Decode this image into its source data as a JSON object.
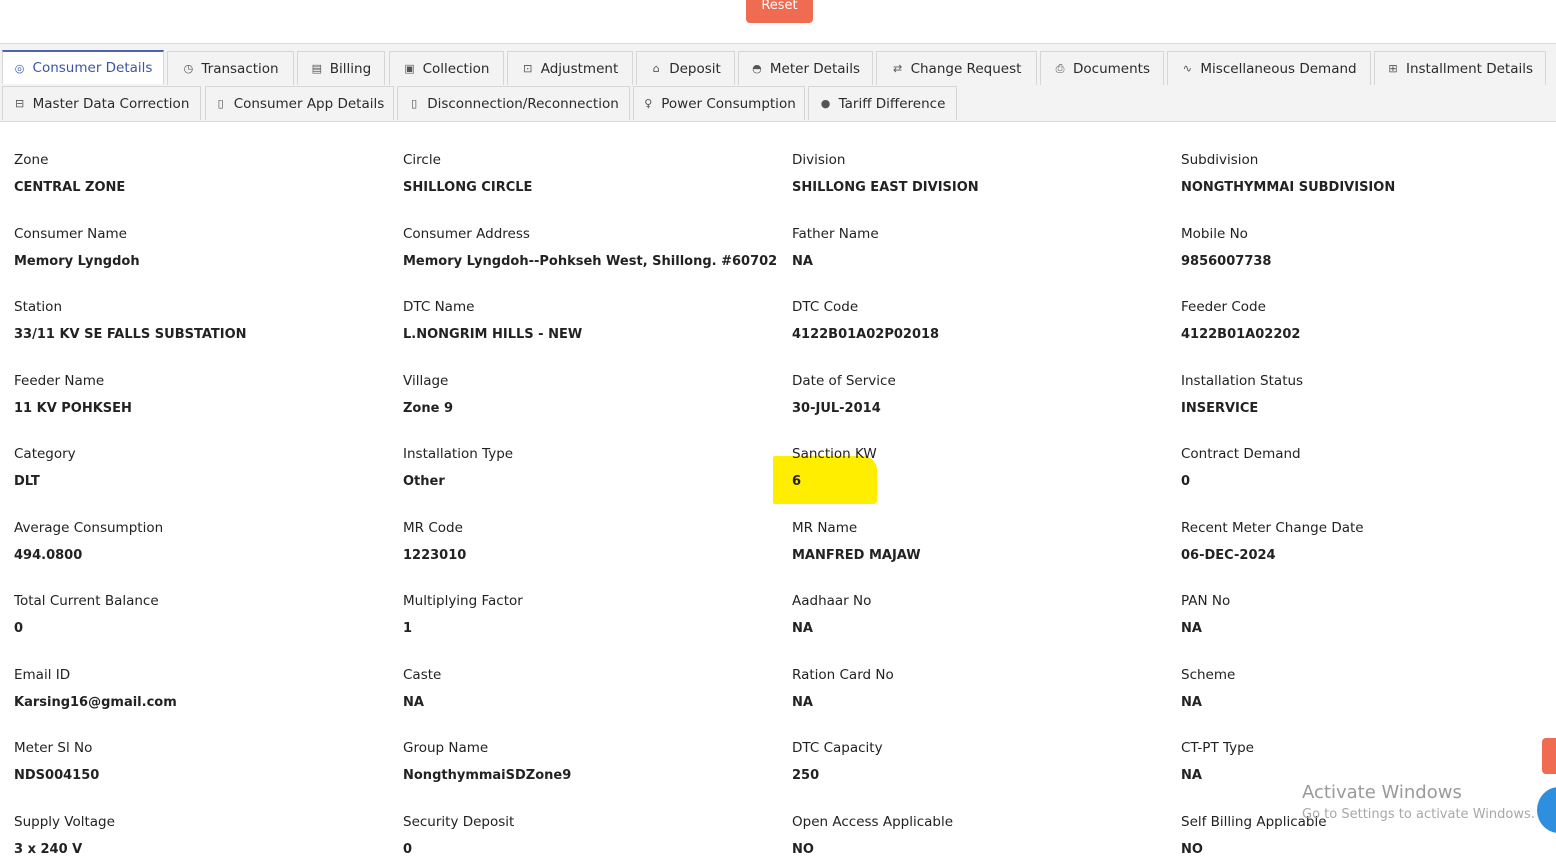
{
  "header": {
    "reset_label": "Reset"
  },
  "tabs": [
    {
      "label": "Consumer Details",
      "icon": "gear-circle-icon",
      "glyph": "◎",
      "active": true
    },
    {
      "label": "Transaction",
      "icon": "clock-icon",
      "glyph": "◷"
    },
    {
      "label": "Billing",
      "icon": "bill-icon",
      "glyph": "▤"
    },
    {
      "label": "Collection",
      "icon": "collection-icon",
      "glyph": "▣"
    },
    {
      "label": "Adjustment",
      "icon": "adjustment-icon",
      "glyph": "⊡"
    },
    {
      "label": "Deposit",
      "icon": "bank-icon",
      "glyph": "⌂"
    },
    {
      "label": "Meter Details",
      "icon": "gauge-icon",
      "glyph": "◓"
    },
    {
      "label": "Change Request",
      "icon": "change-icon",
      "glyph": "⇄"
    },
    {
      "label": "Documents",
      "icon": "document-icon",
      "glyph": "⎙"
    },
    {
      "label": "Miscellaneous Demand",
      "icon": "activity-icon",
      "glyph": "∿"
    },
    {
      "label": "Installment Details",
      "icon": "installment-icon",
      "glyph": "⊞"
    },
    {
      "label": "Master Data Correction",
      "icon": "data-correction-icon",
      "glyph": "⊟"
    },
    {
      "label": "Consumer App Details",
      "icon": "mobile-icon",
      "glyph": "▯"
    },
    {
      "label": "Disconnection/Reconnection",
      "icon": "plug-icon",
      "glyph": "▯"
    },
    {
      "label": "Power Consumption",
      "icon": "bulb-icon",
      "glyph": "♀"
    },
    {
      "label": "Tariff Difference",
      "icon": "dot-icon",
      "glyph": "●"
    }
  ],
  "fields": [
    [
      {
        "label": "Zone",
        "value": "CENTRAL ZONE"
      },
      {
        "label": "Circle",
        "value": "SHILLONG CIRCLE"
      },
      {
        "label": "Division",
        "value": "SHILLONG EAST DIVISION"
      },
      {
        "label": "Subdivision",
        "value": "NONGTHYMMAI SUBDIVISION"
      }
    ],
    [
      {
        "label": "Consumer Name",
        "value": "Memory Lyngdoh"
      },
      {
        "label": "Consumer Address",
        "value": "Memory Lyngdoh--Pohkseh West, Shillong. #60702"
      },
      {
        "label": "Father Name",
        "value": "NA"
      },
      {
        "label": "Mobile No",
        "value": "9856007738"
      }
    ],
    [
      {
        "label": "Station",
        "value": "33/11 KV SE FALLS SUBSTATION"
      },
      {
        "label": "DTC Name",
        "value": "L.NONGRIM HILLS - NEW"
      },
      {
        "label": "DTC Code",
        "value": "4122B01A02P02018"
      },
      {
        "label": "Feeder Code",
        "value": "4122B01A02202"
      }
    ],
    [
      {
        "label": "Feeder Name",
        "value": "11 KV POHKSEH"
      },
      {
        "label": "Village",
        "value": "Zone 9"
      },
      {
        "label": "Date of Service",
        "value": "30-JUL-2014"
      },
      {
        "label": "Installation Status",
        "value": "INSERVICE"
      }
    ],
    [
      {
        "label": "Category",
        "value": "DLT"
      },
      {
        "label": "Installation Type",
        "value": "Other"
      },
      {
        "label": "Sanction KW",
        "value": "6"
      },
      {
        "label": "Contract Demand",
        "value": "0"
      }
    ],
    [
      {
        "label": "Average Consumption",
        "value": "494.0800"
      },
      {
        "label": "MR Code",
        "value": "1223010"
      },
      {
        "label": "MR Name",
        "value": "MANFRED MAJAW"
      },
      {
        "label": "Recent Meter Change Date",
        "value": "06-DEC-2024"
      }
    ],
    [
      {
        "label": "Total Current Balance",
        "value": "0"
      },
      {
        "label": "Multiplying Factor",
        "value": "1"
      },
      {
        "label": "Aadhaar No",
        "value": "NA"
      },
      {
        "label": "PAN No",
        "value": "NA"
      }
    ],
    [
      {
        "label": "Email ID",
        "value": "Karsing16@gmail.com"
      },
      {
        "label": "Caste",
        "value": "NA"
      },
      {
        "label": "Ration Card No",
        "value": "NA"
      },
      {
        "label": "Scheme",
        "value": "NA"
      }
    ],
    [
      {
        "label": "Meter Sl No",
        "value": "NDS004150"
      },
      {
        "label": "Group Name",
        "value": "NongthymmaiSDZone9"
      },
      {
        "label": "DTC Capacity",
        "value": "250"
      },
      {
        "label": "CT-PT Type",
        "value": "NA"
      }
    ],
    [
      {
        "label": "Supply Voltage",
        "value": "3 x 240 V"
      },
      {
        "label": "Security Deposit",
        "value": "0"
      },
      {
        "label": "Open Access Applicable",
        "value": "NO"
      },
      {
        "label": "Self Billing Applicable",
        "value": "NO"
      }
    ]
  ],
  "watermark": {
    "title": "Activate Windows",
    "subtitle": "Go to Settings to activate Windows."
  },
  "colors": {
    "accent": "#4a63b5",
    "reset": "#ef6b51",
    "highlight": "#ffee00"
  }
}
